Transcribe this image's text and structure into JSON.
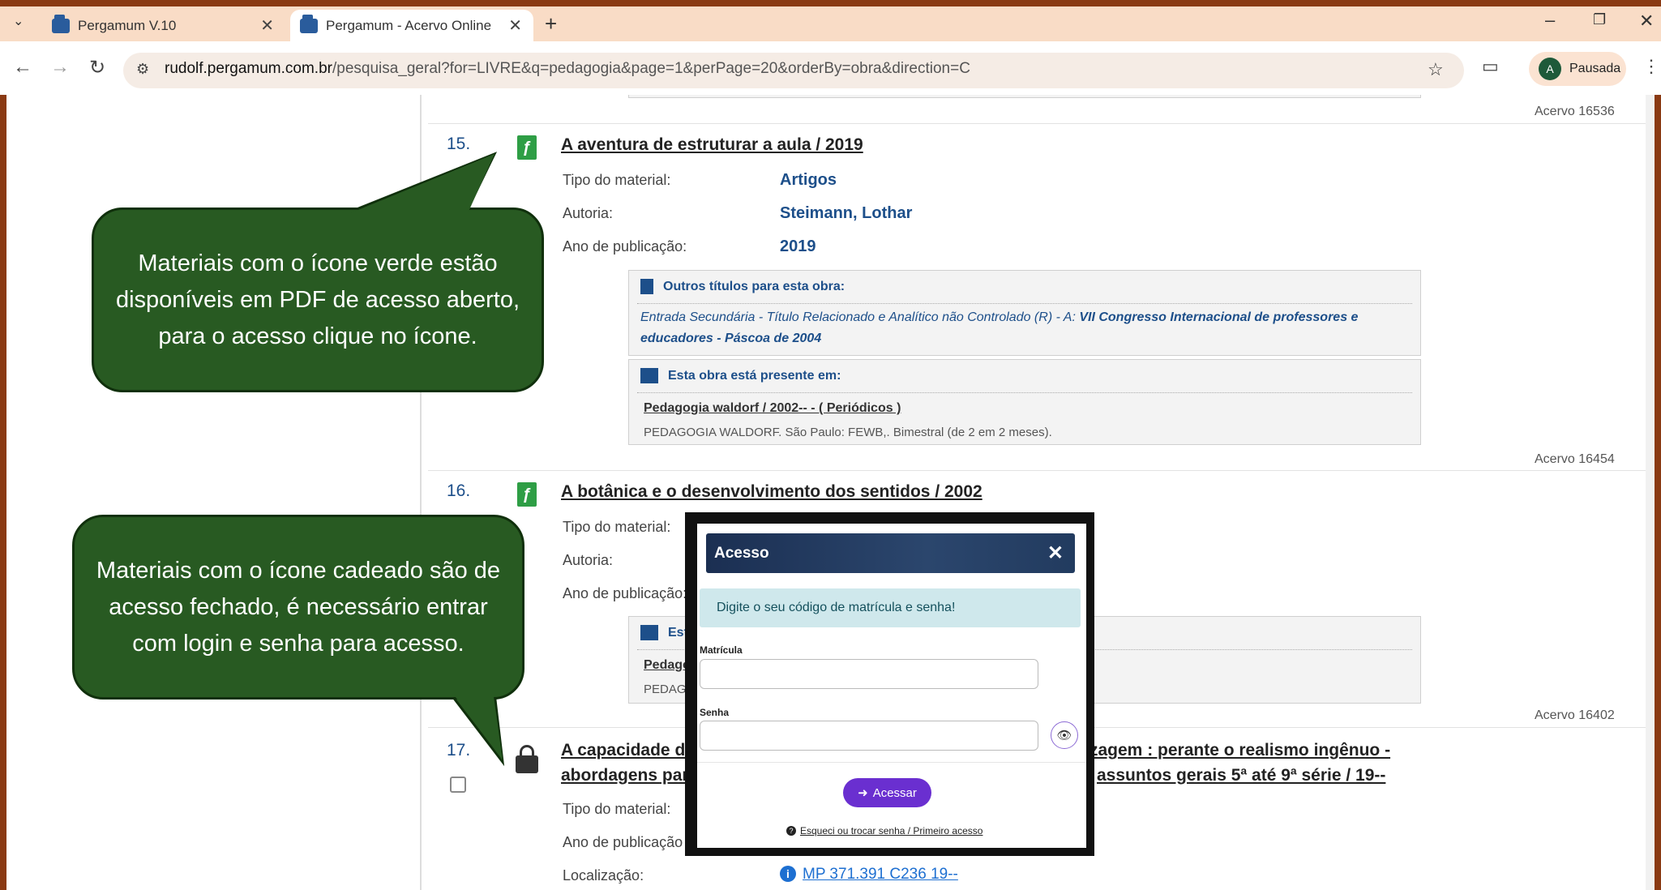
{
  "browser": {
    "tabs": [
      {
        "label": "Pergamum V.10"
      },
      {
        "label": "Pergamum - Acervo Online"
      }
    ],
    "url_domain": "rudolf.pergamum.com.br",
    "url_path": "/pesquisa_geral?for=LIVRE&q=pedagogia&page=1&perPage=20&orderBy=obra&direction=C",
    "profile_initial": "A",
    "profile_label": "Pausada"
  },
  "results": {
    "acervo_top": "Acervo 16536",
    "item15": {
      "num": "15.",
      "title": "A aventura de estruturar a aula / 2019",
      "tipo_label": "Tipo do material:",
      "tipo_value": "Artigos",
      "autoria_label": "Autoria:",
      "autoria_value": "Steimann, Lothar",
      "ano_label": "Ano de publicação:",
      "ano_value": "2019",
      "outros_head": "Outros títulos para esta obra:",
      "outros_text": "Entrada Secundária - Título Relacionado e Analítico não Controlado (R) - A:",
      "outros_bold": "VII Congresso Internacional de professores e educadores - Páscoa de 2004",
      "presente_head": "Esta obra está presente em:",
      "presente_link": "Pedagogia waldorf / 2002-- - ( Periódicos )",
      "presente_desc": "PEDAGOGIA WALDORF. São Paulo: FEWB,. Bimestral (de 2 em 2 meses).",
      "acervo": "Acervo 16454"
    },
    "item16": {
      "num": "16.",
      "title": "A botânica e o desenvolvimento dos sentidos / 2002",
      "tipo_label": "Tipo do material:",
      "autoria_label": "Autoria:",
      "ano_label": "Ano de publicação:",
      "presente_head_partial": "Est",
      "presente_link_partial": "Pedago",
      "presente_desc_partial": "PEDAGO",
      "acervo": "Acervo 16402"
    },
    "item17": {
      "num": "17.",
      "title_line1_a": "A capacidade de",
      "title_line1_b": "zagem : perante o realismo ingênuo -",
      "title_line2_a": "abordagens para",
      "title_line2_b": "assuntos gerais 5ª até 9ª série / 19--",
      "tipo_label": "Tipo do material:",
      "ano_label": "Ano de publicação",
      "loc_label": "Localização:",
      "loc_value": "MP 371.391 C236 19--"
    }
  },
  "callouts": {
    "green": "Materiais com o ícone verde estão disponíveis em PDF de acesso aberto, para o acesso clique no ícone.",
    "lock": "Materiais com o ícone cadeado são de acesso fechado, é necessário entrar com login e senha para acesso."
  },
  "modal": {
    "title": "Acesso",
    "info": "Digite o seu código de matrícula e senha!",
    "matricula_label": "Matrícula",
    "senha_label": "Senha",
    "button": "Acessar",
    "forgot": "Esqueci ou trocar senha / Primeiro acesso"
  }
}
